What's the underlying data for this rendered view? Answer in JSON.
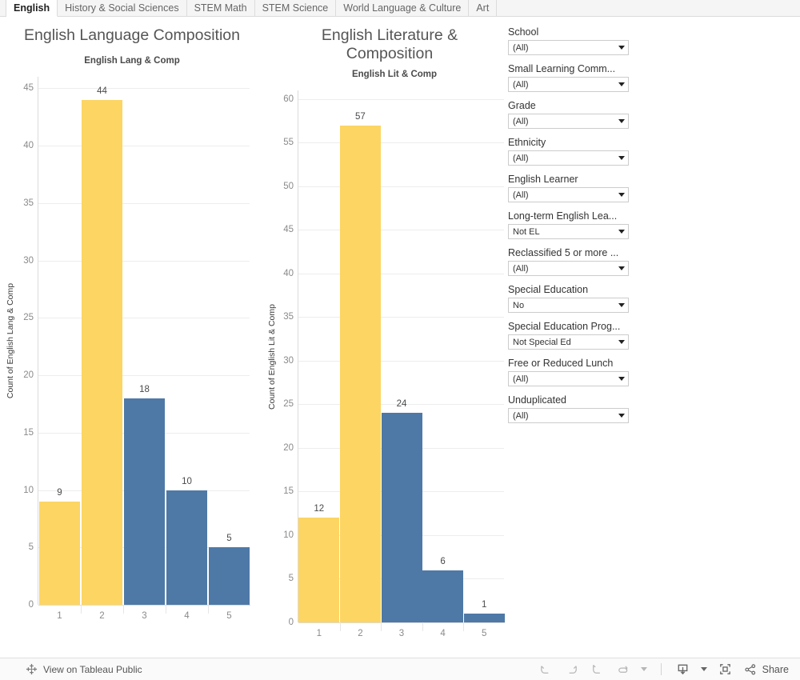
{
  "tabs": [
    {
      "label": "English",
      "active": true
    },
    {
      "label": "History & Social Sciences",
      "active": false
    },
    {
      "label": "STEM Math",
      "active": false
    },
    {
      "label": "STEM Science",
      "active": false
    },
    {
      "label": "World Language & Culture",
      "active": false
    },
    {
      "label": "Art",
      "active": false
    }
  ],
  "colors": {
    "yellow": "#FCD563",
    "blue": "#4E79A7",
    "gridline": "#ededed",
    "axis": "#dcdcdc"
  },
  "charts": [
    {
      "title": "English Language Composition",
      "subtitle": "English Lang & Comp",
      "ylabel": "Count of English Lang & Comp"
    },
    {
      "title": "English Literature & Composition",
      "subtitle": "English Lit & Comp",
      "ylabel": "Count of English Lit & Comp"
    }
  ],
  "chart_data": [
    {
      "type": "bar",
      "title": "English Language Composition",
      "subtitle": "English Lang & Comp",
      "xlabel": "",
      "ylabel": "Count of English Lang & Comp",
      "categories": [
        "1",
        "2",
        "3",
        "4",
        "5"
      ],
      "values": [
        9,
        44,
        18,
        10,
        5
      ],
      "bar_colors": [
        "#FCD563",
        "#FCD563",
        "#4E79A7",
        "#4E79A7",
        "#4E79A7"
      ],
      "ylim": [
        0,
        46
      ],
      "yticks": [
        0,
        5,
        10,
        15,
        20,
        25,
        30,
        35,
        40,
        45
      ],
      "grid": true,
      "legend": "none"
    },
    {
      "type": "bar",
      "title": "English Literature & Composition",
      "subtitle": "English Lit & Comp",
      "xlabel": "",
      "ylabel": "Count of English Lit & Comp",
      "categories": [
        "1",
        "2",
        "3",
        "4",
        "5"
      ],
      "values": [
        12,
        57,
        24,
        6,
        1
      ],
      "bar_colors": [
        "#FCD563",
        "#FCD563",
        "#4E79A7",
        "#4E79A7",
        "#4E79A7"
      ],
      "ylim": [
        0,
        61
      ],
      "yticks": [
        0,
        5,
        10,
        15,
        20,
        25,
        30,
        35,
        40,
        45,
        50,
        55,
        60
      ],
      "grid": true,
      "legend": "none"
    }
  ],
  "filters": [
    {
      "label": "School",
      "value": "(All)"
    },
    {
      "label": "Small Learning Comm...",
      "value": "(All)"
    },
    {
      "label": "Grade",
      "value": "(All)"
    },
    {
      "label": "Ethnicity",
      "value": "(All)"
    },
    {
      "label": "English Learner",
      "value": "(All)"
    },
    {
      "label": "Long-term English Lea...",
      "value": "Not EL"
    },
    {
      "label": "Reclassified 5 or more ...",
      "value": "(All)"
    },
    {
      "label": "Special Education",
      "value": "No"
    },
    {
      "label": "Special Education Prog...",
      "value": "Not Special Ed"
    },
    {
      "label": "Free or Reduced Lunch",
      "value": "(All)"
    },
    {
      "label": "Unduplicated",
      "value": "(All)"
    }
  ],
  "toolbar": {
    "view_on_tableau_label": "View on Tableau Public",
    "tableau_icon": "tableau-logo-icon",
    "share_label": "Share",
    "icons": [
      "undo-icon",
      "redo-icon",
      "revert-icon",
      "refresh-icon",
      "refresh-dropdown-caret-icon",
      "download-icon",
      "download-dropdown-caret-icon",
      "fullscreen-icon",
      "share-icon"
    ]
  }
}
